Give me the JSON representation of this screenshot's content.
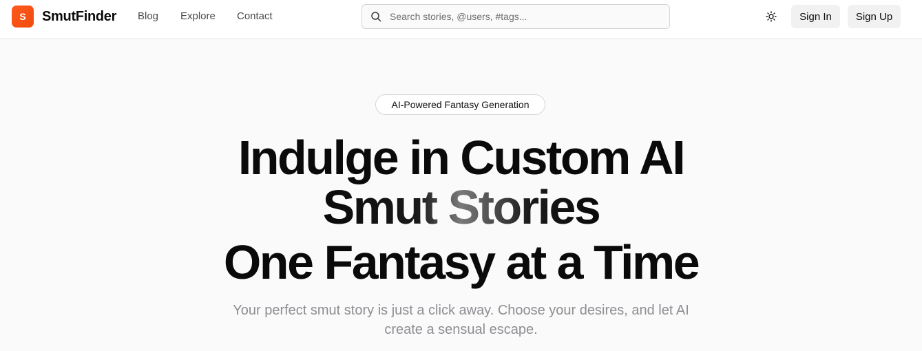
{
  "header": {
    "logo_letter": "S",
    "brand": "SmutFinder",
    "nav": [
      {
        "label": "Blog"
      },
      {
        "label": "Explore"
      },
      {
        "label": "Contact"
      }
    ],
    "search": {
      "placeholder": "Search stories, @users, #tags..."
    },
    "theme_icon": "sun-icon",
    "sign_in": "Sign In",
    "sign_up": "Sign Up"
  },
  "hero": {
    "badge": "AI-Powered Fantasy Generation",
    "headline_line1": "Indulge in Custom AI",
    "headline_line2": "Smut Stories",
    "headline_line3": "One Fantasy at a Time",
    "subtitle": "Your perfect smut story is just a click away. Choose your desires, and let AI create a sensual escape."
  },
  "colors": {
    "accent": "#ff5a1f",
    "background": "#fafafa",
    "text": "#0a0a0a",
    "muted": "#8d8d93"
  }
}
